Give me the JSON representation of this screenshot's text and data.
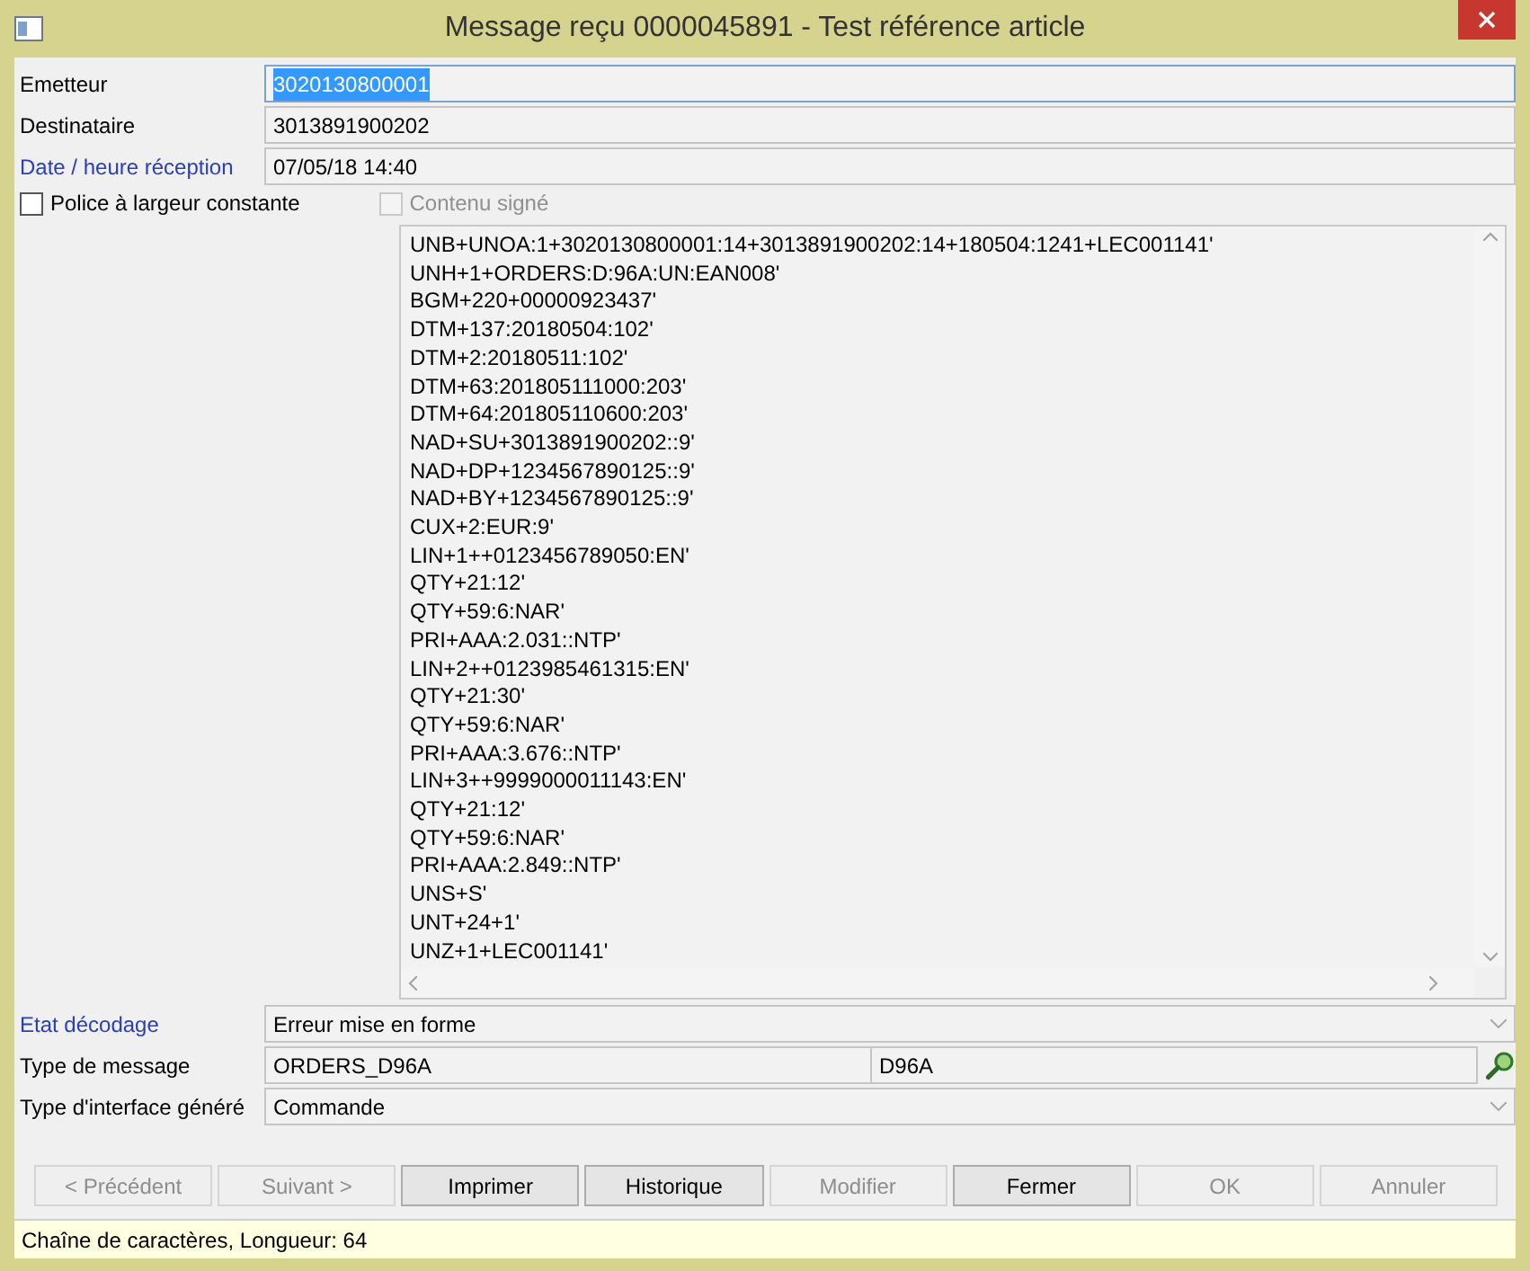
{
  "window": {
    "title": "Message reçu 0000045891 - Test référence article"
  },
  "header_fields": [
    {
      "label": "Emetteur",
      "label_link": false,
      "value": "3020130800001",
      "text_selected": true
    },
    {
      "label": "Destinataire",
      "label_link": false,
      "value": "3013891900202",
      "text_selected": false
    },
    {
      "label": "Date / heure réception",
      "label_link": true,
      "value": "07/05/18 14:40",
      "text_selected": false
    }
  ],
  "options": [
    {
      "label": "Police à largeur constante",
      "checked": false,
      "disabled": false
    },
    {
      "label": "Contenu signé",
      "checked": false,
      "disabled": true
    }
  ],
  "message_lines": [
    "UNB+UNOA:1+3020130800001:14+3013891900202:14+180504:1241+LEC001141'",
    "UNH+1+ORDERS:D:96A:UN:EAN008'",
    "BGM+220+00000923437'",
    "DTM+137:20180504:102'",
    "DTM+2:20180511:102'",
    "DTM+63:201805111000:203'",
    "DTM+64:201805110600:203'",
    "NAD+SU+3013891900202::9'",
    "NAD+DP+1234567890125::9'",
    "NAD+BY+1234567890125::9'",
    "CUX+2:EUR:9'",
    "LIN+1++0123456789050:EN'",
    "QTY+21:12'",
    "QTY+59:6:NAR'",
    "PRI+AAA:2.031::NTP'",
    "LIN+2++0123985461315:EN'",
    "QTY+21:30'",
    "QTY+59:6:NAR'",
    "PRI+AAA:3.676::NTP'",
    "LIN+3++9999000011143:EN'",
    "QTY+21:12'",
    "QTY+59:6:NAR'",
    "PRI+AAA:2.849::NTP'",
    "UNS+S'",
    "UNT+24+1'",
    "UNZ+1+LEC001141'"
  ],
  "footer_fields": [
    {
      "kind": "select",
      "label": "Etat décodage",
      "label_link": true,
      "values": [
        "Erreur mise en forme"
      ]
    },
    {
      "kind": "pair",
      "label": "Type de message",
      "label_link": false,
      "values": [
        "ORDERS_D96A",
        "D96A"
      ]
    },
    {
      "kind": "select",
      "label": "Type d'interface généré",
      "label_link": false,
      "values": [
        "Commande"
      ]
    }
  ],
  "buttons": [
    {
      "label": "< Précédent",
      "disabled": true
    },
    {
      "label": "Suivant >",
      "disabled": true
    },
    {
      "label": "Imprimer",
      "disabled": false
    },
    {
      "label": "Historique",
      "disabled": false
    },
    {
      "label": "Modifier",
      "disabled": true
    },
    {
      "label": "Fermer",
      "disabled": false
    },
    {
      "label": "OK",
      "disabled": true
    },
    {
      "label": "Annuler",
      "disabled": true
    }
  ],
  "status_bar": "Chaîne de caractères, Longueur: 64"
}
